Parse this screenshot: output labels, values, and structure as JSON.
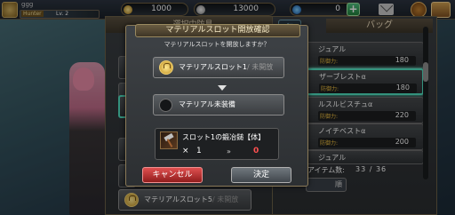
{
  "hud": {
    "player_name": "ggg",
    "rank_label": "Hunter",
    "level": "Lv. 2",
    "currency_1": "1000",
    "currency_2": "13000",
    "currency_3": "0"
  },
  "equip_panel": {
    "header": "選択中防具",
    "bottom_slot_label": "マテリアルスロット5",
    "bottom_slot_status": "未開放"
  },
  "bag": {
    "back_icon": "back-arrow-icon",
    "title": "バッグ",
    "items": [
      {
        "name": "ジュアル",
        "stat_label": "防御力:",
        "value": "180"
      },
      {
        "name": "ザーブレストα",
        "stat_label": "防御力:",
        "value": "180"
      },
      {
        "name": "ルスルビスチュα",
        "stat_label": "防御力:",
        "value": "220"
      },
      {
        "name": "ノイチベストα",
        "stat_label": "防御力:",
        "value": "200"
      },
      {
        "name": "ジュアル",
        "stat_label": "",
        "value": ""
      }
    ],
    "count_label": "アイテム数:",
    "count_value": "33 / 36",
    "sort_label": "順"
  },
  "dialog": {
    "title": "マテリアルスロット開放確認",
    "question": "マテリアルスロットを開放しますか？",
    "slot_label": "マテリアルスロット1",
    "slot_status": "未開放",
    "result_label": "マテリアル未装備",
    "material_name": "スロット1の鍛冶鎚【体】",
    "material_qty_prefix": "×",
    "material_qty": "1",
    "arrow_symbol": "»",
    "material_after": "0",
    "cancel_label": "キャンセル",
    "confirm_label": "決定"
  },
  "colors": {
    "accent_selected": "#50e0c0",
    "cancel_red": "#e05050",
    "warning_red": "#ff5050"
  }
}
